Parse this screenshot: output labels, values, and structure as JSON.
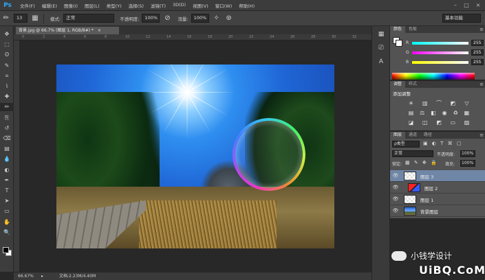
{
  "app": {
    "logo": "Ps"
  },
  "menu": [
    "文件(F)",
    "编辑(E)",
    "图像(I)",
    "图层(L)",
    "类型(Y)",
    "选择(S)",
    "滤镜(T)",
    "3D(D)",
    "视图(V)",
    "窗口(W)",
    "帮助(H)"
  ],
  "window_controls": [
    "–",
    "□",
    "×"
  ],
  "options": {
    "brush_size": "13",
    "mode_label": "模式:",
    "mode_value": "正常",
    "opacity_label": "不透明度:",
    "opacity_value": "100%",
    "flow_label": "流量:",
    "flow_value": "100%",
    "workspace": "基本功能"
  },
  "document": {
    "tab_title": "背景.jpg @ 66.7% (图层 1, RGB/8#) *",
    "tab_close": "×",
    "zoom": "66.67%",
    "doc_info": "文档:2.23M/4.40M",
    "ruler_ticks": [
      "0",
      "2",
      "4",
      "6",
      "8",
      "10",
      "12",
      "14",
      "16",
      "18",
      "20",
      "22",
      "24",
      "26",
      "28",
      "30",
      "32"
    ]
  },
  "tools": [
    "move-icon",
    "marquee-icon",
    "lasso-icon",
    "quick-select-icon",
    "crop-icon",
    "eyedropper-icon",
    "healing-icon",
    "brush-icon",
    "stamp-icon",
    "history-brush-icon",
    "eraser-icon",
    "gradient-icon",
    "blur-icon",
    "dodge-icon",
    "pen-icon",
    "type-icon",
    "path-select-icon",
    "shape-icon",
    "hand-icon",
    "zoom-icon"
  ],
  "tool_glyphs": [
    "✥",
    "⬚",
    "ʘ",
    "✎",
    "⌗",
    "⌇",
    "✚",
    "✏",
    "⎘",
    "↺",
    "⌫",
    "▤",
    "💧",
    "◐",
    "✒",
    "T",
    "➤",
    "▭",
    "✋",
    "🔍"
  ],
  "color_panel": {
    "tabs": [
      "颜色",
      "色板"
    ],
    "r_label": "R",
    "r_value": "255",
    "g_label": "G",
    "g_value": "255",
    "b_label": "B",
    "b_value": "255"
  },
  "adjust_panel": {
    "tabs": [
      "调整",
      "样式"
    ],
    "title": "添加调整"
  },
  "layers_panel": {
    "tabs": [
      "图层",
      "通道",
      "路径"
    ],
    "kind_filter": "ρ类型",
    "blend_mode": "正常",
    "opacity_label": "不透明度:",
    "opacity_value": "100%",
    "lock_label": "锁定:",
    "fill_label": "填充:",
    "fill_value": "100%",
    "layers": [
      {
        "name": "图层 3",
        "selected": true
      },
      {
        "name": "图层 2",
        "selected": false
      },
      {
        "name": "图层 1",
        "selected": false
      },
      {
        "name": "背景图层",
        "selected": false
      }
    ]
  },
  "watermark": {
    "line1": "小钱学设计",
    "line2": "UiBQ.CoM"
  },
  "colors": {
    "accent": "#31a8ff",
    "selected_layer": "#6f86a6"
  }
}
